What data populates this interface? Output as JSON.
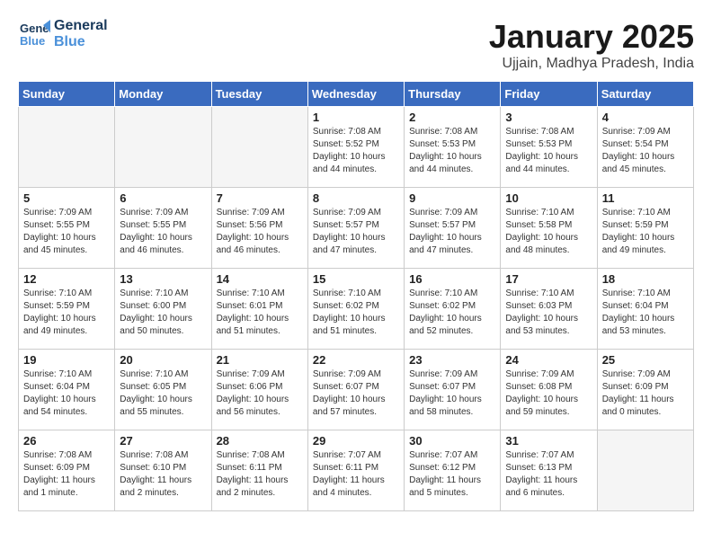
{
  "header": {
    "logo_line1": "General",
    "logo_line2": "Blue",
    "month_title": "January 2025",
    "subtitle": "Ujjain, Madhya Pradesh, India"
  },
  "weekdays": [
    "Sunday",
    "Monday",
    "Tuesday",
    "Wednesday",
    "Thursday",
    "Friday",
    "Saturday"
  ],
  "weeks": [
    [
      {
        "day": "",
        "empty": true
      },
      {
        "day": "",
        "empty": true
      },
      {
        "day": "",
        "empty": true
      },
      {
        "day": "1",
        "sunrise": "7:08 AM",
        "sunset": "5:52 PM",
        "daylight": "10 hours and 44 minutes."
      },
      {
        "day": "2",
        "sunrise": "7:08 AM",
        "sunset": "5:53 PM",
        "daylight": "10 hours and 44 minutes."
      },
      {
        "day": "3",
        "sunrise": "7:08 AM",
        "sunset": "5:53 PM",
        "daylight": "10 hours and 44 minutes."
      },
      {
        "day": "4",
        "sunrise": "7:09 AM",
        "sunset": "5:54 PM",
        "daylight": "10 hours and 45 minutes."
      }
    ],
    [
      {
        "day": "5",
        "sunrise": "7:09 AM",
        "sunset": "5:55 PM",
        "daylight": "10 hours and 45 minutes."
      },
      {
        "day": "6",
        "sunrise": "7:09 AM",
        "sunset": "5:55 PM",
        "daylight": "10 hours and 46 minutes."
      },
      {
        "day": "7",
        "sunrise": "7:09 AM",
        "sunset": "5:56 PM",
        "daylight": "10 hours and 46 minutes."
      },
      {
        "day": "8",
        "sunrise": "7:09 AM",
        "sunset": "5:57 PM",
        "daylight": "10 hours and 47 minutes."
      },
      {
        "day": "9",
        "sunrise": "7:09 AM",
        "sunset": "5:57 PM",
        "daylight": "10 hours and 47 minutes."
      },
      {
        "day": "10",
        "sunrise": "7:10 AM",
        "sunset": "5:58 PM",
        "daylight": "10 hours and 48 minutes."
      },
      {
        "day": "11",
        "sunrise": "7:10 AM",
        "sunset": "5:59 PM",
        "daylight": "10 hours and 49 minutes."
      }
    ],
    [
      {
        "day": "12",
        "sunrise": "7:10 AM",
        "sunset": "5:59 PM",
        "daylight": "10 hours and 49 minutes."
      },
      {
        "day": "13",
        "sunrise": "7:10 AM",
        "sunset": "6:00 PM",
        "daylight": "10 hours and 50 minutes."
      },
      {
        "day": "14",
        "sunrise": "7:10 AM",
        "sunset": "6:01 PM",
        "daylight": "10 hours and 51 minutes."
      },
      {
        "day": "15",
        "sunrise": "7:10 AM",
        "sunset": "6:02 PM",
        "daylight": "10 hours and 51 minutes."
      },
      {
        "day": "16",
        "sunrise": "7:10 AM",
        "sunset": "6:02 PM",
        "daylight": "10 hours and 52 minutes."
      },
      {
        "day": "17",
        "sunrise": "7:10 AM",
        "sunset": "6:03 PM",
        "daylight": "10 hours and 53 minutes."
      },
      {
        "day": "18",
        "sunrise": "7:10 AM",
        "sunset": "6:04 PM",
        "daylight": "10 hours and 53 minutes."
      }
    ],
    [
      {
        "day": "19",
        "sunrise": "7:10 AM",
        "sunset": "6:04 PM",
        "daylight": "10 hours and 54 minutes."
      },
      {
        "day": "20",
        "sunrise": "7:10 AM",
        "sunset": "6:05 PM",
        "daylight": "10 hours and 55 minutes."
      },
      {
        "day": "21",
        "sunrise": "7:09 AM",
        "sunset": "6:06 PM",
        "daylight": "10 hours and 56 minutes."
      },
      {
        "day": "22",
        "sunrise": "7:09 AM",
        "sunset": "6:07 PM",
        "daylight": "10 hours and 57 minutes."
      },
      {
        "day": "23",
        "sunrise": "7:09 AM",
        "sunset": "6:07 PM",
        "daylight": "10 hours and 58 minutes."
      },
      {
        "day": "24",
        "sunrise": "7:09 AM",
        "sunset": "6:08 PM",
        "daylight": "10 hours and 59 minutes."
      },
      {
        "day": "25",
        "sunrise": "7:09 AM",
        "sunset": "6:09 PM",
        "daylight": "11 hours and 0 minutes."
      }
    ],
    [
      {
        "day": "26",
        "sunrise": "7:08 AM",
        "sunset": "6:09 PM",
        "daylight": "11 hours and 1 minute."
      },
      {
        "day": "27",
        "sunrise": "7:08 AM",
        "sunset": "6:10 PM",
        "daylight": "11 hours and 2 minutes."
      },
      {
        "day": "28",
        "sunrise": "7:08 AM",
        "sunset": "6:11 PM",
        "daylight": "11 hours and 2 minutes."
      },
      {
        "day": "29",
        "sunrise": "7:07 AM",
        "sunset": "6:11 PM",
        "daylight": "11 hours and 4 minutes."
      },
      {
        "day": "30",
        "sunrise": "7:07 AM",
        "sunset": "6:12 PM",
        "daylight": "11 hours and 5 minutes."
      },
      {
        "day": "31",
        "sunrise": "7:07 AM",
        "sunset": "6:13 PM",
        "daylight": "11 hours and 6 minutes."
      },
      {
        "day": "",
        "empty": true
      }
    ]
  ],
  "labels": {
    "sunrise": "Sunrise:",
    "sunset": "Sunset:",
    "daylight": "Daylight:"
  }
}
